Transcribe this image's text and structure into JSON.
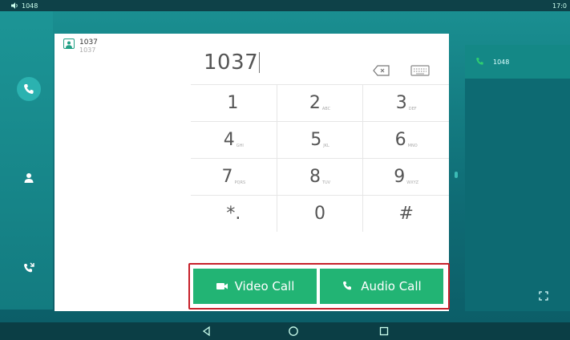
{
  "status_bar": {
    "line": "1048",
    "time": "17:0"
  },
  "contacts": [
    {
      "name": "1037",
      "number": "1037"
    }
  ],
  "dialer": {
    "number": "1037",
    "keys": [
      [
        {
          "digit": "1",
          "sub": ""
        },
        {
          "digit": "2",
          "sub": "ABC"
        },
        {
          "digit": "3",
          "sub": "DEF"
        }
      ],
      [
        {
          "digit": "4",
          "sub": "GHI"
        },
        {
          "digit": "5",
          "sub": "JKL"
        },
        {
          "digit": "6",
          "sub": "MNO"
        }
      ],
      [
        {
          "digit": "7",
          "sub": "PQRS"
        },
        {
          "digit": "8",
          "sub": "TUV"
        },
        {
          "digit": "9",
          "sub": "WXYZ"
        }
      ],
      [
        {
          "digit": "*.",
          "sub": ""
        },
        {
          "digit": "0",
          "sub": ""
        },
        {
          "digit": "#",
          "sub": ""
        }
      ]
    ]
  },
  "actions": {
    "video_call_label": "Video Call",
    "audio_call_label": "Audio Call"
  },
  "right_panel": {
    "line_label": "1048"
  },
  "icons": {
    "rail": [
      "phone-icon",
      "contact-icon",
      "call-history-icon"
    ],
    "nav": [
      "back-icon",
      "home-icon",
      "recents-icon"
    ]
  },
  "colors": {
    "accent_green": "#22b474",
    "highlight_red": "#c7202a",
    "teal": "#1a8f91"
  }
}
